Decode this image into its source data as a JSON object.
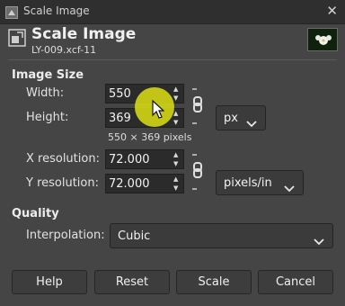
{
  "window": {
    "title": "Scale Image",
    "close_glyph": "✕"
  },
  "header": {
    "title": "Scale Image",
    "subtitle": "LY-009.xcf-11"
  },
  "image_size": {
    "section_label": "Image Size",
    "width_label": "Width:",
    "width_value": "550",
    "height_label": "Height:",
    "height_value": "369",
    "unit": "px",
    "pixel_summary": "550 × 369 pixels"
  },
  "resolution": {
    "x_label": "X resolution:",
    "x_value": "72.000",
    "y_label": "Y resolution:",
    "y_value": "72.000",
    "unit": "pixels/in"
  },
  "quality": {
    "section_label": "Quality",
    "interpolation_label": "Interpolation:",
    "interpolation_value": "Cubic"
  },
  "buttons": {
    "help": "Help",
    "reset": "Reset",
    "scale": "Scale",
    "cancel": "Cancel"
  },
  "colors": {
    "background": "#454545",
    "titlebar": "#2f2f2f",
    "cursor_highlight": "#d4d614"
  }
}
